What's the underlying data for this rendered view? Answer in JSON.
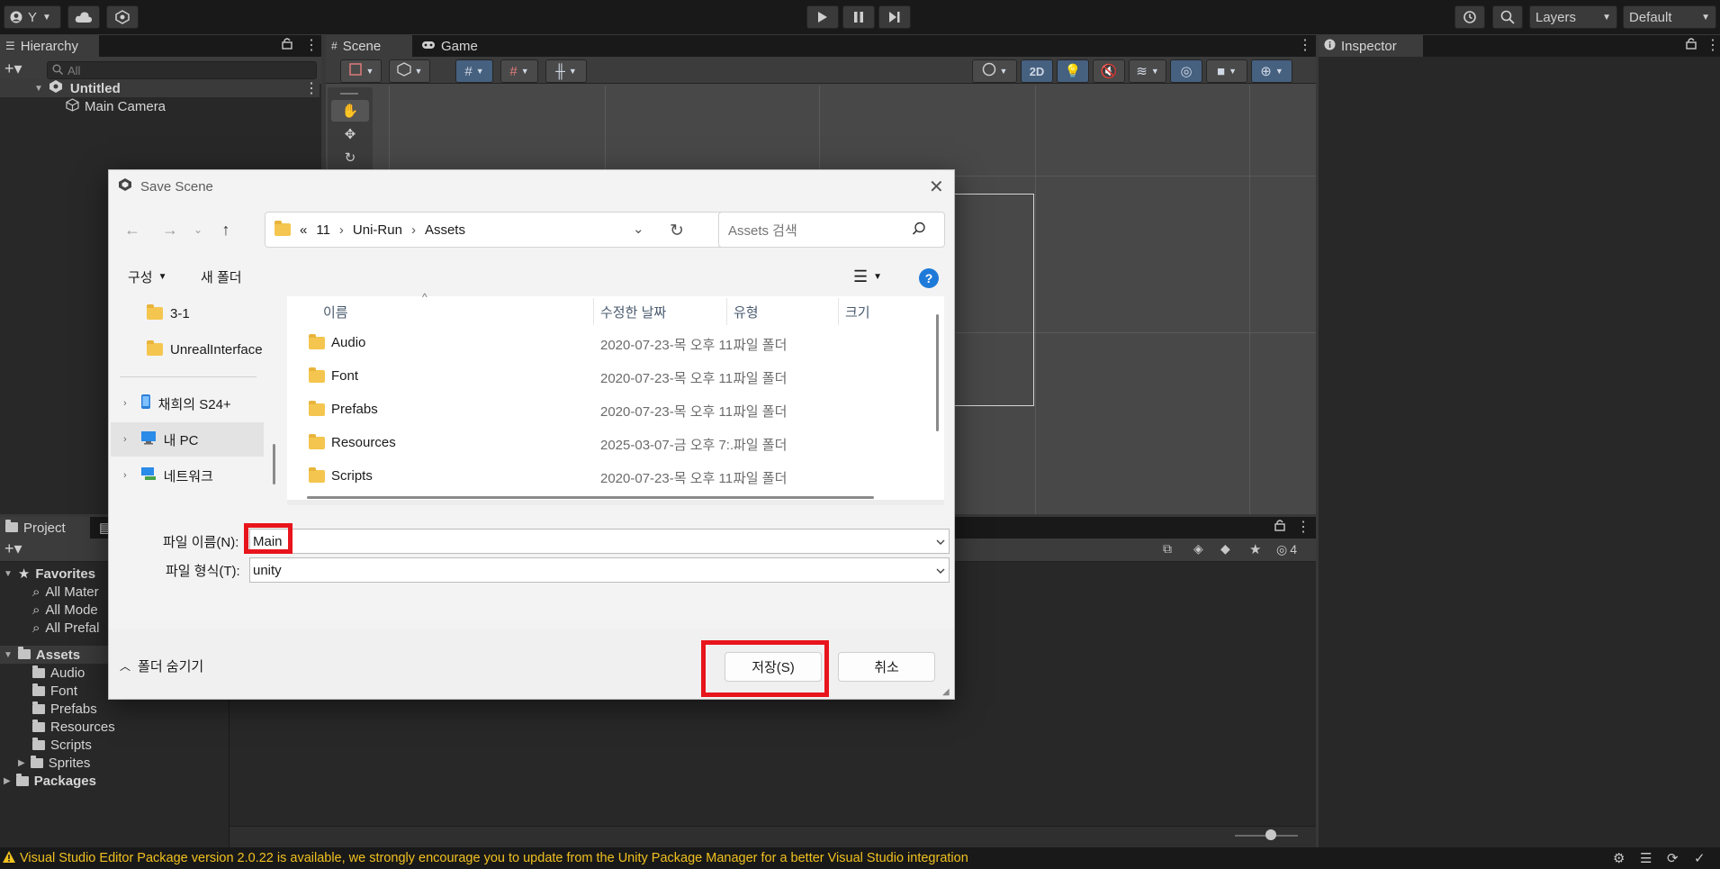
{
  "toolbar": {
    "account_label": "Y",
    "layers_label": "Layers",
    "layout_label": "Default"
  },
  "hierarchy": {
    "tab_label": "Hierarchy",
    "search_placeholder": "All",
    "scene_name": "Untitled",
    "objects": [
      "Main Camera"
    ]
  },
  "scene": {
    "tabs": [
      "Scene",
      "Game"
    ],
    "mode_2d_label": "2D"
  },
  "inspector": {
    "tab_label": "Inspector"
  },
  "project": {
    "tab_label": "Project",
    "favorites_label": "Favorites",
    "favorites": [
      "All Mater",
      "All Mode",
      "All Prefal"
    ],
    "assets_label": "Assets",
    "asset_folders": [
      "Audio",
      "Font",
      "Prefabs",
      "Resources",
      "Scripts",
      "Sprites"
    ],
    "packages_label": "Packages",
    "hidden_count": "4"
  },
  "status": {
    "message": "Visual Studio Editor Package version 2.0.22 is available, we strongly encourage you to update from the Unity Package Manager for a better Visual Studio integration"
  },
  "dialog": {
    "title": "Save Scene",
    "breadcrumb": [
      "«",
      "11",
      "Uni-Run",
      "Assets"
    ],
    "search_placeholder": "Assets 검색",
    "organize_label": "구성",
    "new_folder_label": "새 폴더",
    "help_label": "?",
    "nav_pane": [
      {
        "label": "3-1",
        "kind": "folder"
      },
      {
        "label": "UnrealInterface",
        "kind": "folder"
      },
      {
        "label": "채희의 S24+",
        "kind": "phone"
      },
      {
        "label": "내 PC",
        "kind": "pc"
      },
      {
        "label": "네트워크",
        "kind": "network"
      }
    ],
    "columns": [
      "이름",
      "수정한 날짜",
      "유형",
      "크기"
    ],
    "files": [
      {
        "name": "Audio",
        "date": "2020-07-23-목 오후 11...",
        "type": "파일 폴더"
      },
      {
        "name": "Font",
        "date": "2020-07-23-목 오후 11...",
        "type": "파일 폴더"
      },
      {
        "name": "Prefabs",
        "date": "2020-07-23-목 오후 11...",
        "type": "파일 폴더"
      },
      {
        "name": "Resources",
        "date": "2025-03-07-금 오후 7:...",
        "type": "파일 폴더"
      },
      {
        "name": "Scripts",
        "date": "2020-07-23-목 오후 11...",
        "type": "파일 폴더"
      }
    ],
    "filename_label": "파일 이름(N):",
    "filename_value": "Main",
    "filetype_label": "파일 형식(T):",
    "filetype_value": "unity",
    "hide_folders_label": "폴더 숨기기",
    "save_label": "저장(S)",
    "cancel_label": "취소",
    "highlight_color": "#e8141b"
  }
}
